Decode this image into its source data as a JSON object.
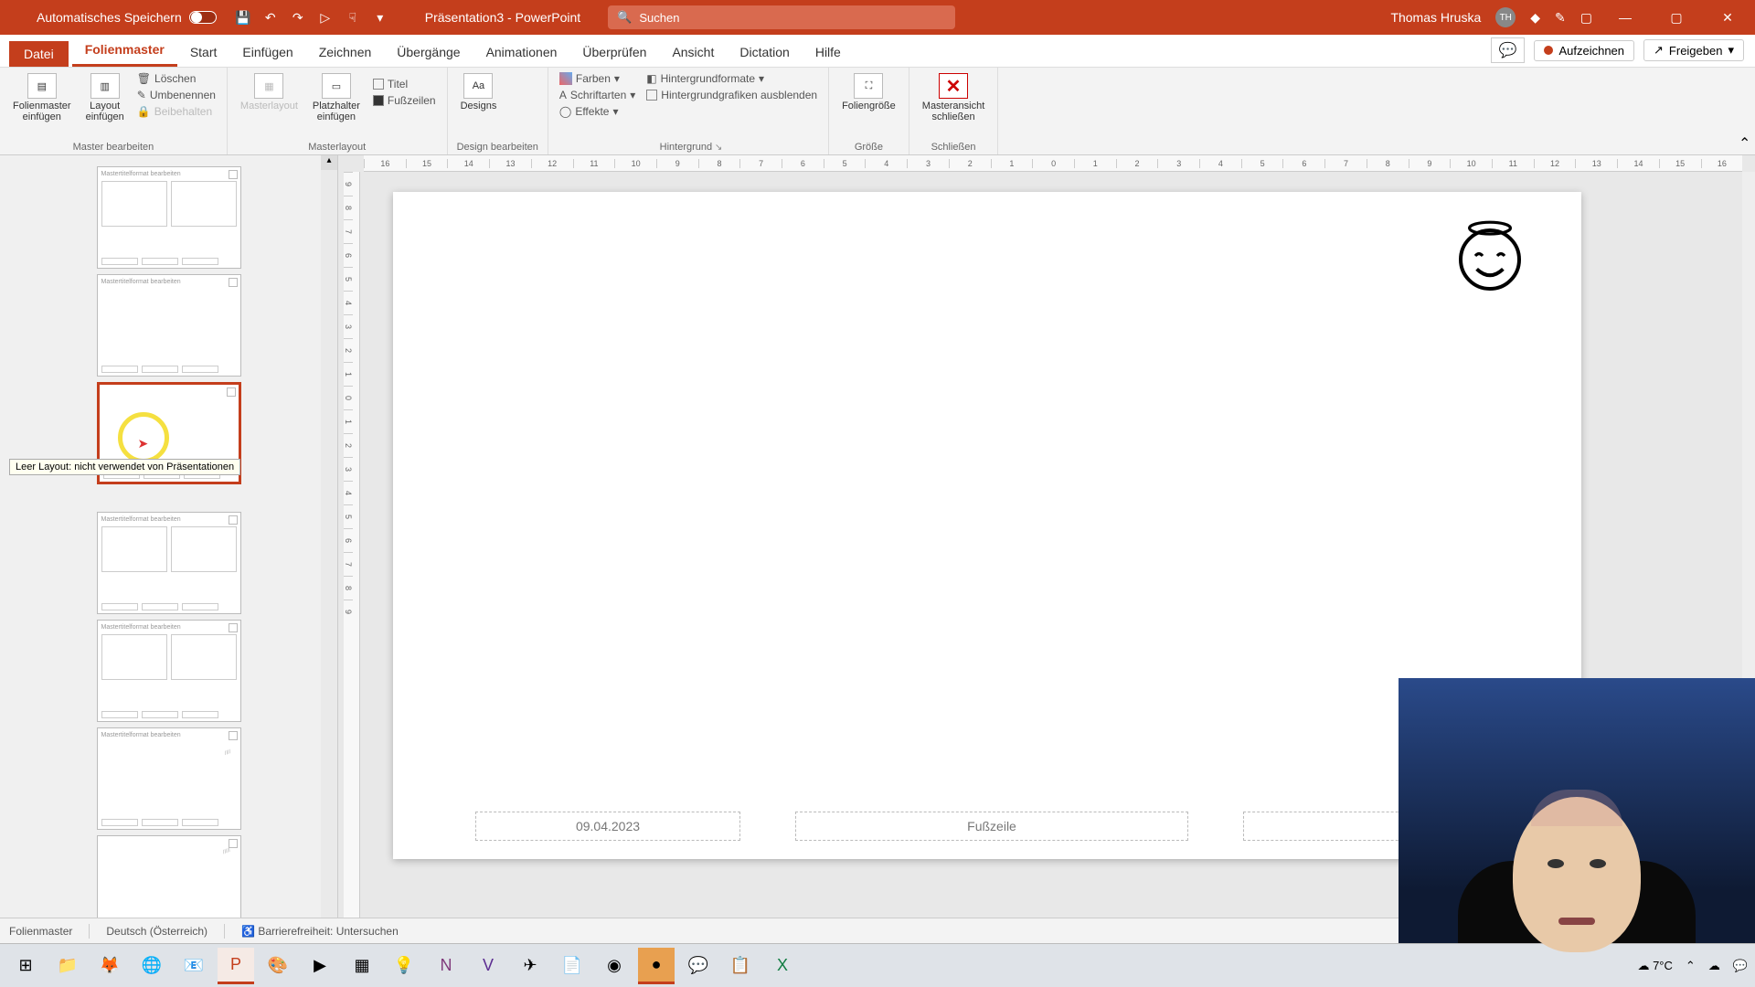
{
  "titlebar": {
    "autosave_label": "Automatisches Speichern",
    "doc_title": "Präsentation3 - PowerPoint",
    "search_placeholder": "Suchen",
    "username": "Thomas Hruska",
    "avatar_initials": "TH"
  },
  "tabs": {
    "datei": "Datei",
    "folienmaster": "Folienmaster",
    "start": "Start",
    "einfuegen": "Einfügen",
    "zeichnen": "Zeichnen",
    "uebergaenge": "Übergänge",
    "animationen": "Animationen",
    "ueberpruefen": "Überprüfen",
    "ansicht": "Ansicht",
    "dictation": "Dictation",
    "hilfe": "Hilfe",
    "aufzeichnen": "Aufzeichnen",
    "freigeben": "Freigeben"
  },
  "ribbon": {
    "master_bearbeiten": {
      "folienmaster_einfuegen": "Folienmaster\neinfügen",
      "layout_einfuegen": "Layout\neinfügen",
      "loeschen": "Löschen",
      "umbenennen": "Umbenennen",
      "beibehalten": "Beibehalten",
      "group": "Master bearbeiten"
    },
    "masterlayout": {
      "masterlayout": "Masterlayout",
      "platzhalter": "Platzhalter\neinfügen",
      "titel": "Titel",
      "fusszeilen": "Fußzeilen",
      "group": "Masterlayout"
    },
    "design": {
      "designs": "Designs",
      "group": "Design bearbeiten"
    },
    "hintergrund": {
      "farben": "Farben",
      "schriftarten": "Schriftarten",
      "effekte": "Effekte",
      "formate": "Hintergrundformate",
      "ausblenden": "Hintergrundgrafiken ausblenden",
      "group": "Hintergrund"
    },
    "groesse": {
      "foliengroesse": "Foliengröße",
      "group": "Größe"
    },
    "schliessen": {
      "masteransicht": "Masteransicht\nschließen",
      "group": "Schließen"
    }
  },
  "thumbs": {
    "placeholder_text": "Mastertitelformat bearbeiten",
    "tooltip": "Leer Layout: nicht verwendet von Präsentationen"
  },
  "slide": {
    "date": "09.04.2023",
    "footer": "Fußzeile"
  },
  "statusbar": {
    "view": "Folienmaster",
    "language": "Deutsch (Österreich)",
    "accessibility": "Barrierefreiheit: Untersuchen"
  },
  "ruler_h": [
    "16",
    "15",
    "14",
    "13",
    "12",
    "11",
    "10",
    "9",
    "8",
    "7",
    "6",
    "5",
    "4",
    "3",
    "2",
    "1",
    "0",
    "1",
    "2",
    "3",
    "4",
    "5",
    "6",
    "7",
    "8",
    "9",
    "10",
    "11",
    "12",
    "13",
    "14",
    "15",
    "16"
  ],
  "taskbar": {
    "temp": "7°C"
  }
}
